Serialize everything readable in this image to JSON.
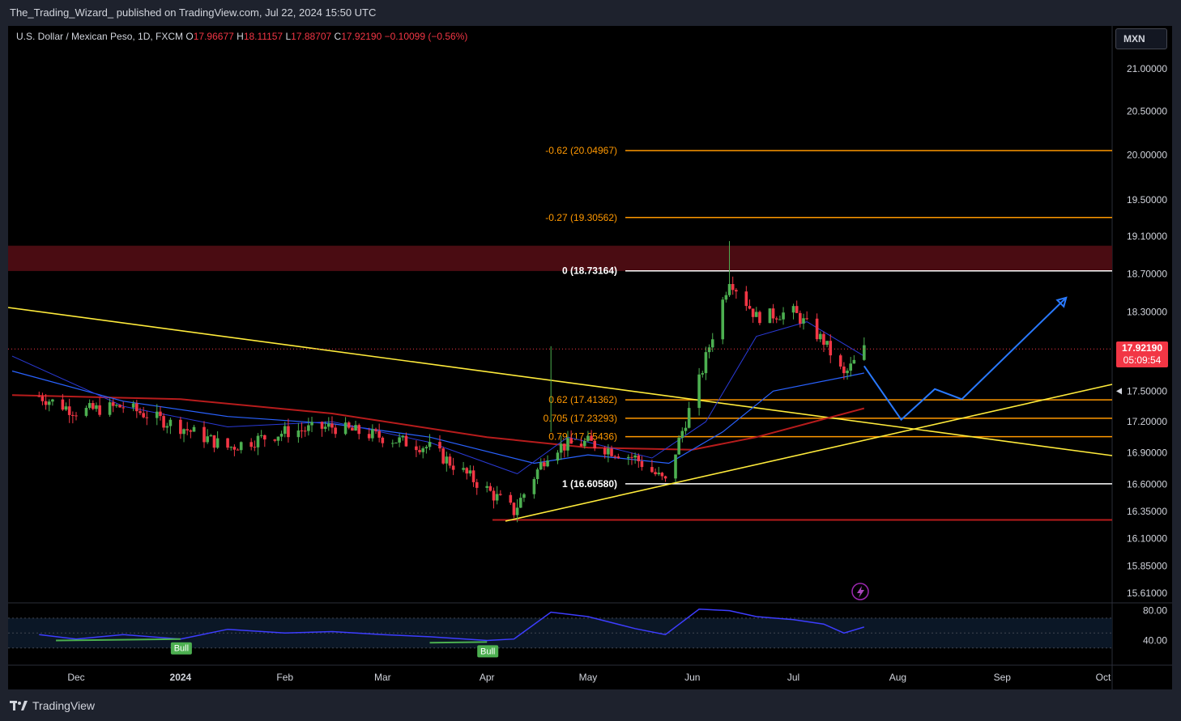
{
  "header": {
    "published": "The_Trading_Wizard_ published on TradingView.com, Jul 22, 2024 15:50 UTC"
  },
  "ticker": {
    "symbol": "U.S. Dollar / Mexican Peso, 1D, FXCM",
    "o_label": "O",
    "o": "17.96677",
    "h_label": "H",
    "h": "18.11157",
    "l_label": "L",
    "l": "17.88707",
    "c_label": "C",
    "c": "17.92190",
    "change": "−0.10099 (−0.56%)"
  },
  "currency_button": "MXN",
  "last_price": {
    "value": "17.92190",
    "countdown": "05:09:54"
  },
  "footer": {
    "brand": "TradingView"
  },
  "colors": {
    "background": "#000000",
    "up": "#4caf50",
    "down": "#f23645",
    "fib": "#ff9800",
    "trendline": "#ffeb3b",
    "ma_blue": "#2962ff",
    "ma_red": "#b71c1c",
    "projection": "#2979ff",
    "rsi": "#3d3dff"
  },
  "chart_data": [
    {
      "type": "line",
      "y_axis_ticks": [
        "21.00000",
        "20.50000",
        "20.00000",
        "19.50000",
        "19.10000",
        "18.70000",
        "18.30000",
        "17.50000",
        "17.20000",
        "16.90000",
        "16.60000",
        "16.35000",
        "16.10000",
        "15.85000",
        "15.61000"
      ],
      "y_axis_scale": "log",
      "x_axis_ticks": [
        "Dec",
        "2024",
        "Feb",
        "Mar",
        "Apr",
        "May",
        "Jun",
        "Jul",
        "Aug",
        "Sep",
        "Oct"
      ],
      "ylim": [
        15.6,
        21.3
      ],
      "fib_levels": [
        {
          "ratio": "-0.62",
          "price": "20.04967",
          "label": "-0.62 (20.04967)"
        },
        {
          "ratio": "-0.27",
          "price": "19.30562",
          "label": "-0.27 (19.30562)"
        },
        {
          "ratio": "0",
          "price": "18.73164",
          "label": "0 (18.73164)"
        },
        {
          "ratio": "0.62",
          "price": "17.41362",
          "label": "0.62 (17.41362)"
        },
        {
          "ratio": "0.705",
          "price": "17.23293",
          "label": "0.705 (17.23293)"
        },
        {
          "ratio": "0.79",
          "price": "17.05436",
          "label": "0.79 (17.05436)"
        },
        {
          "ratio": "1",
          "price": "16.60580",
          "label": "1 (16.60580)"
        }
      ],
      "resistance_zone": [
        18.73,
        19.0
      ],
      "support_line": 16.27,
      "price_series": {
        "name": "",
        "dates": [
          "2023-11-20",
          "2023-12-01",
          "2023-12-15",
          "2024-01-01",
          "2024-01-15",
          "2024-02-01",
          "2024-02-15",
          "2024-03-01",
          "2024-03-15",
          "2024-04-01",
          "2024-04-09",
          "2024-04-20",
          "2024-05-01",
          "2024-05-15",
          "2024-05-24",
          "2024-06-03",
          "2024-06-12",
          "2024-06-20",
          "2024-07-01",
          "2024-07-10",
          "2024-07-16",
          "2024-07-22"
        ],
        "close": [
          17.45,
          17.3,
          17.35,
          17.15,
          16.95,
          17.1,
          17.15,
          17.05,
          16.95,
          16.55,
          16.35,
          16.95,
          17.0,
          16.85,
          16.62,
          17.6,
          18.65,
          18.25,
          18.3,
          18.0,
          17.65,
          17.92
        ]
      },
      "projection_path": {
        "dates": [
          "2024-07-22",
          "2024-08-02",
          "2024-08-12",
          "2024-08-20",
          "2024-09-20"
        ],
        "price": [
          17.75,
          17.22,
          17.52,
          17.42,
          18.45
        ]
      }
    },
    {
      "type": "line",
      "name": "",
      "y_axis_ticks": [
        "80.00",
        "40.00"
      ],
      "ylim": [
        20,
        85
      ],
      "divergence_labels": [
        "Bull",
        "Bull"
      ],
      "rsi": [
        48,
        42,
        48,
        42,
        55,
        50,
        52,
        48,
        45,
        40,
        42,
        78,
        72,
        56,
        48,
        82,
        80,
        72,
        68,
        62,
        50,
        58
      ]
    }
  ]
}
